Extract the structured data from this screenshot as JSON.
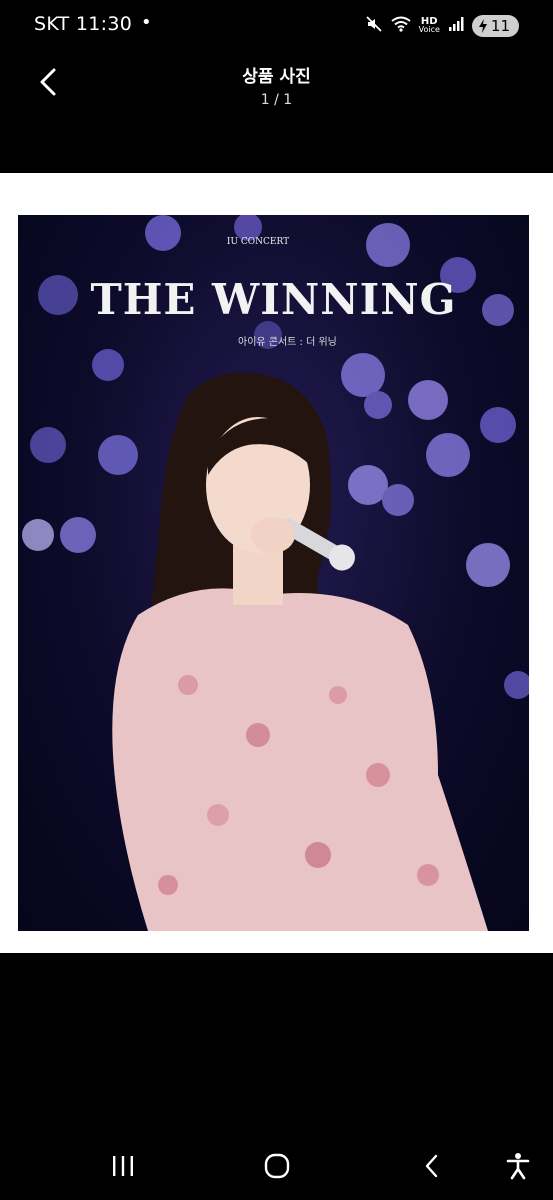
{
  "status_bar": {
    "carrier_time": "SKT 11:30",
    "dot": "•",
    "hd_label": "HD",
    "voice_label": "Voice",
    "battery": "11"
  },
  "header": {
    "title": "상품 사진",
    "counter": "1 / 1"
  },
  "photo": {
    "poster_top": "IU CONCERT",
    "poster_title": "THE WINNING",
    "poster_sub": "아이유 콘서트 : 더 위닝"
  }
}
